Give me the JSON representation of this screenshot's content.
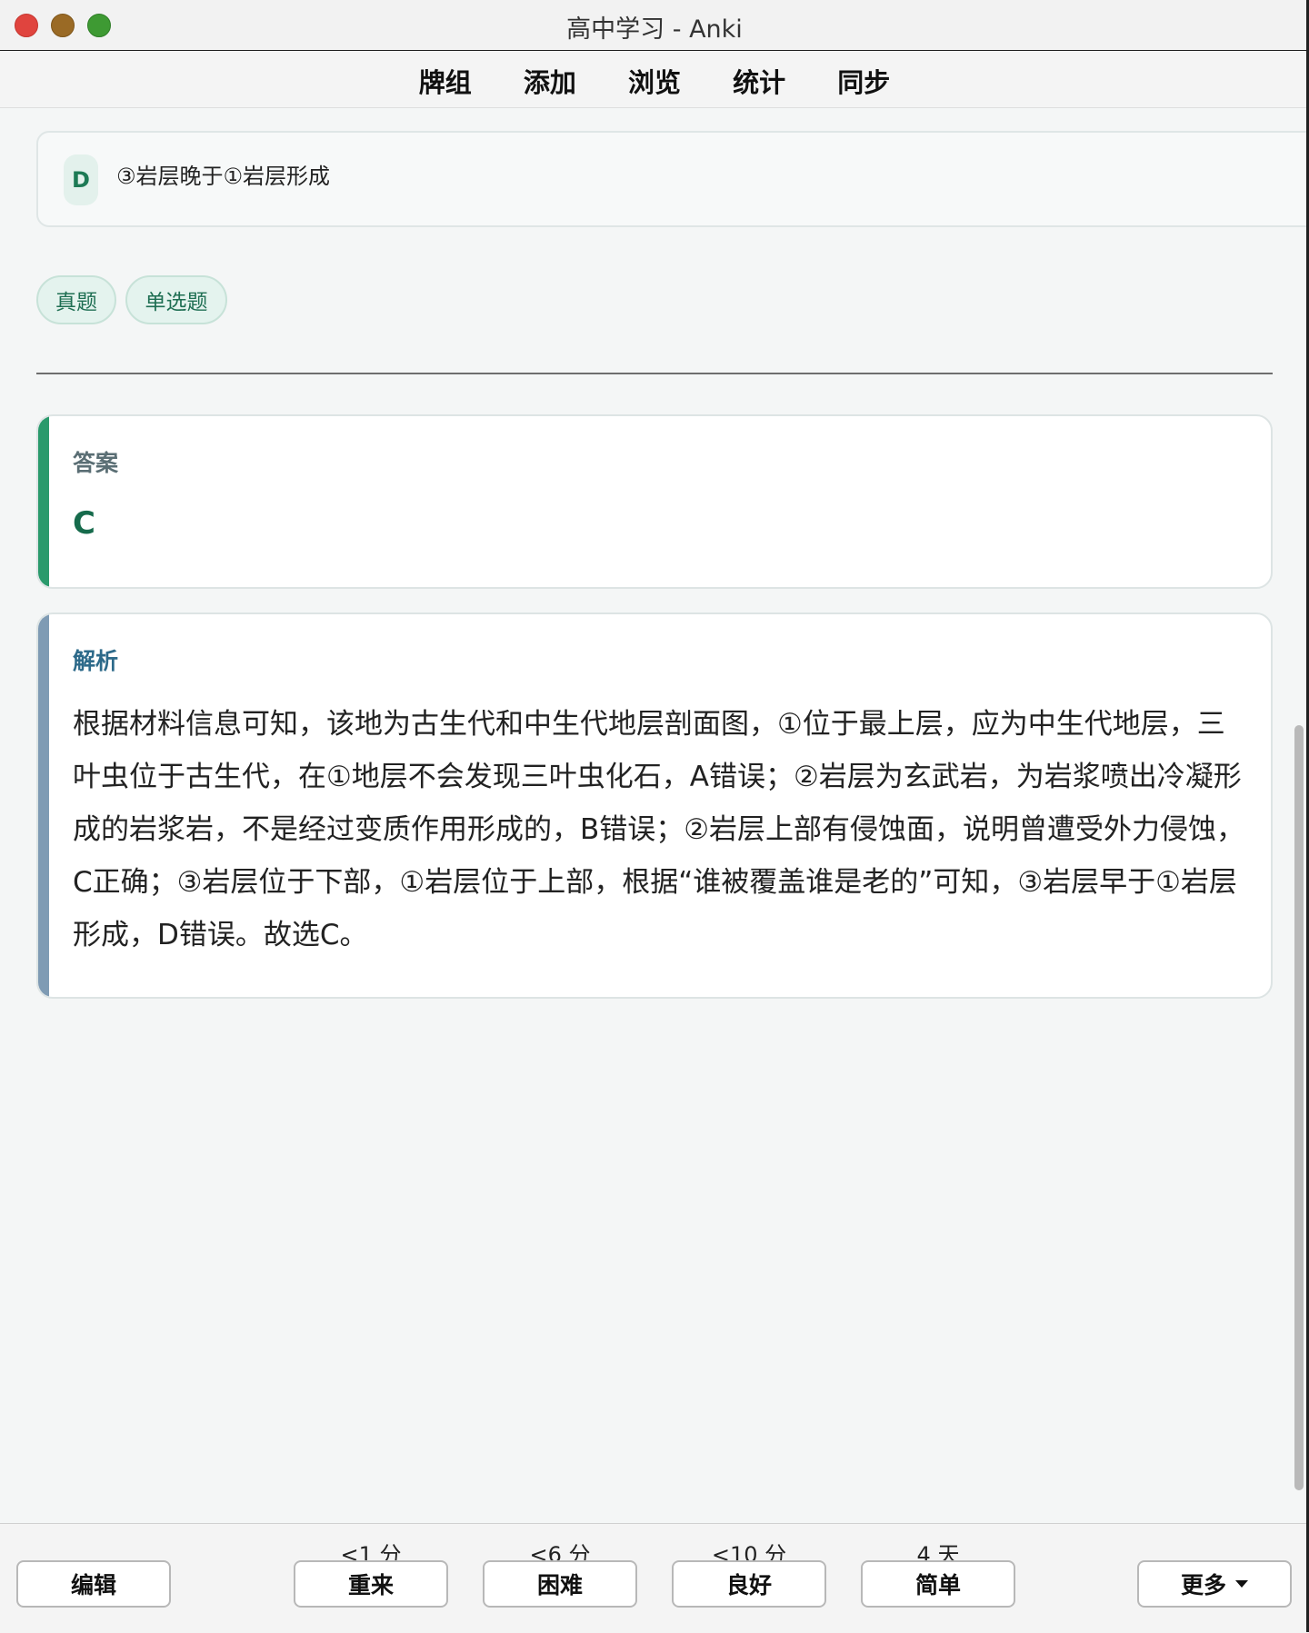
{
  "window": {
    "title": "高中学习 - Anki"
  },
  "menubar": {
    "items": [
      "牌组",
      "添加",
      "浏览",
      "统计",
      "同步"
    ]
  },
  "option": {
    "letter": "D",
    "text": "③岩层晚于①岩层形成"
  },
  "tags": [
    "真题",
    "单选题"
  ],
  "answer": {
    "label": "答案",
    "value": "C"
  },
  "explanation": {
    "label": "解析",
    "text": "根据材料信息可知，该地为古生代和中生代地层剖面图，①位于最上层，应为中生代地层，三叶虫位于古生代，在①地层不会发现三叶虫化石，A错误；②岩层为玄武岩，为岩浆喷出冷凝形成的岩浆岩，不是经过变质作用形成的，B错误；②岩层上部有侵蚀面，说明曾遭受外力侵蚀，C正确；③岩层位于下部，①岩层位于上部，根据“谁被覆盖谁是老的”可知，③岩层早于①岩层形成，D错误。故选C。"
  },
  "bottom": {
    "edit_label": "编辑",
    "more_label": "更多",
    "again": {
      "due": "<1 分",
      "label": "重来"
    },
    "hard": {
      "due": "<6 分",
      "label": "困难"
    },
    "good": {
      "due": "<10 分",
      "label": "良好"
    },
    "easy": {
      "due": "4 天",
      "label": "简单"
    }
  }
}
